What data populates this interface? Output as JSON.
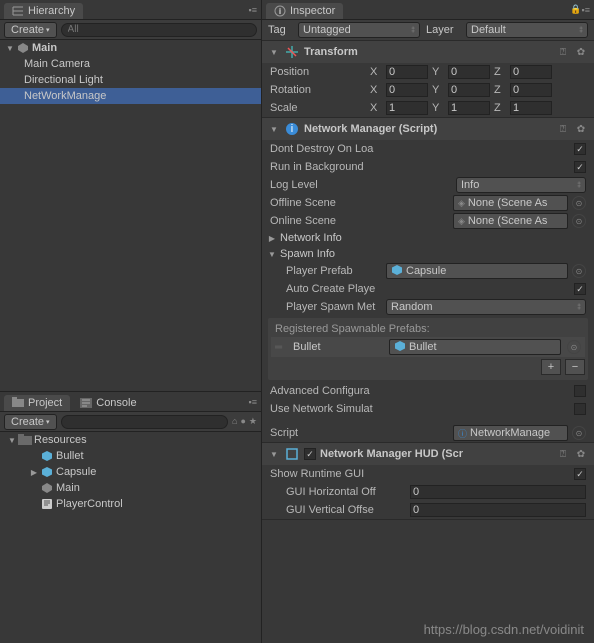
{
  "hierarchy": {
    "title": "Hierarchy",
    "create": "Create",
    "search_placeholder": "All",
    "root": "Main",
    "items": [
      "Main Camera",
      "Directional Light",
      "NetWorkManage"
    ],
    "selected_index": 2
  },
  "project": {
    "tab_project": "Project",
    "tab_console": "Console",
    "create": "Create",
    "root": "Resources",
    "items": [
      {
        "name": "Bullet",
        "type": "prefab"
      },
      {
        "name": "Capsule",
        "type": "prefab"
      },
      {
        "name": "Main",
        "type": "scene"
      },
      {
        "name": "PlayerControl",
        "type": "script"
      }
    ]
  },
  "inspector": {
    "title": "Inspector",
    "tag_label": "Tag",
    "tag_value": "Untagged",
    "layer_label": "Layer",
    "layer_value": "Default"
  },
  "transform": {
    "title": "Transform",
    "position_label": "Position",
    "rotation_label": "Rotation",
    "scale_label": "Scale",
    "pos": {
      "x": "0",
      "y": "0",
      "z": "0"
    },
    "rot": {
      "x": "0",
      "y": "0",
      "z": "0"
    },
    "scl": {
      "x": "1",
      "y": "1",
      "z": "1"
    }
  },
  "netmgr": {
    "title": "Network Manager (Script)",
    "dont_destroy": "Dont Destroy On Loa",
    "run_bg": "Run in Background",
    "log_level_label": "Log Level",
    "log_level_value": "Info",
    "offline_label": "Offline Scene",
    "online_label": "Online Scene",
    "scene_none": "None (Scene As",
    "network_info": "Network Info",
    "spawn_info": "Spawn Info",
    "player_prefab_label": "Player Prefab",
    "player_prefab_value": "Capsule",
    "auto_create": "Auto Create Playe",
    "spawn_method_label": "Player Spawn Met",
    "spawn_method_value": "Random",
    "reg_spawn_label": "Registered Spawnable Prefabs:",
    "reg_item_label": "Bullet",
    "reg_item_value": "Bullet",
    "adv_config": "Advanced Configura",
    "use_sim": "Use Network Simulat",
    "script_label": "Script",
    "script_value": "NetworkManage"
  },
  "hud": {
    "title": "Network Manager HUD (Scr",
    "show_gui": "Show Runtime GUI",
    "h_off_label": "GUI Horizontal Off",
    "h_off_value": "0",
    "v_off_label": "GUI Vertical Offse",
    "v_off_value": "0"
  },
  "axis": {
    "x": "X",
    "y": "Y",
    "z": "Z"
  },
  "watermark": "https://blog.csdn.net/voidinit"
}
